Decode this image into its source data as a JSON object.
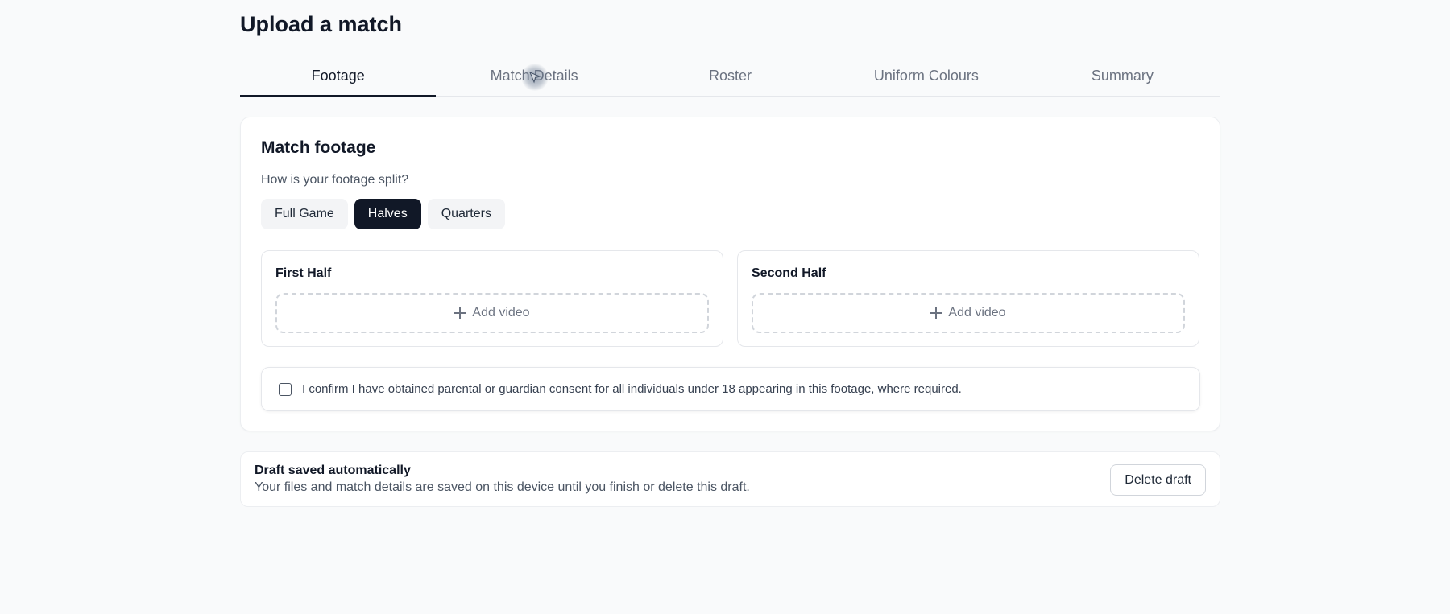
{
  "page": {
    "title": "Upload a match"
  },
  "tabs": [
    {
      "label": "Footage",
      "active": true
    },
    {
      "label": "Match Details",
      "active": false
    },
    {
      "label": "Roster",
      "active": false
    },
    {
      "label": "Uniform Colours",
      "active": false
    },
    {
      "label": "Summary",
      "active": false
    }
  ],
  "footage": {
    "title": "Match footage",
    "question": "How is your footage split?",
    "split_options": [
      {
        "label": "Full Game",
        "selected": false
      },
      {
        "label": "Halves",
        "selected": true
      },
      {
        "label": "Quarters",
        "selected": false
      }
    ],
    "halves": [
      {
        "title": "First Half",
        "add_label": "Add video"
      },
      {
        "title": "Second Half",
        "add_label": "Add video"
      }
    ],
    "consent": {
      "checked": false,
      "text": "I confirm I have obtained parental or guardian consent for all individuals under 18 appearing in this footage, where required."
    }
  },
  "draft": {
    "title": "Draft saved automatically",
    "description": "Your files and match details are saved on this device until you finish or delete this draft.",
    "delete_label": "Delete draft"
  },
  "icons": {
    "add": "plus-icon",
    "cursor": "pointer-cursor-icon"
  },
  "colors": {
    "primary": "#111827",
    "muted_text": "#6b7280",
    "background": "#f9fafb",
    "border": "#e5e7eb"
  }
}
